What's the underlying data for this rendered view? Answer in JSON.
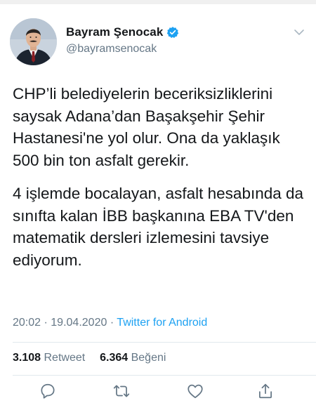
{
  "tweet": {
    "author": {
      "display_name": "Bayram Şenocak",
      "handle": "@bayramsenocak",
      "verified": true,
      "avatar_icon": "avatar-photo"
    },
    "paragraphs": [
      "CHP’li belediyelerin beceriksizliklerini saysak Adana’dan Başakşehir Şehir Hastanesi'ne yol olur. Ona da yaklaşık 500 bin ton asfalt gerekir.",
      "4 işlemde bocalayan, asfalt hesabında da sınıfta kalan İBB başkanına EBA TV'den matematik dersleri izlemesini tavsiye ediyorum."
    ],
    "time": "20:02",
    "separator": "·",
    "date": "19.04.2020",
    "source": "Twitter for Android",
    "retweets": {
      "count": "3.108",
      "label": "Retweet"
    },
    "likes": {
      "count": "6.364",
      "label": "Beğeni"
    }
  },
  "actions": [
    {
      "name": "reply-icon"
    },
    {
      "name": "retweet-icon"
    },
    {
      "name": "like-icon"
    },
    {
      "name": "share-icon"
    }
  ],
  "colors": {
    "text": "#14171a",
    "secondary": "#657786",
    "link": "#1da1f2",
    "divider": "#e1e8ed"
  }
}
